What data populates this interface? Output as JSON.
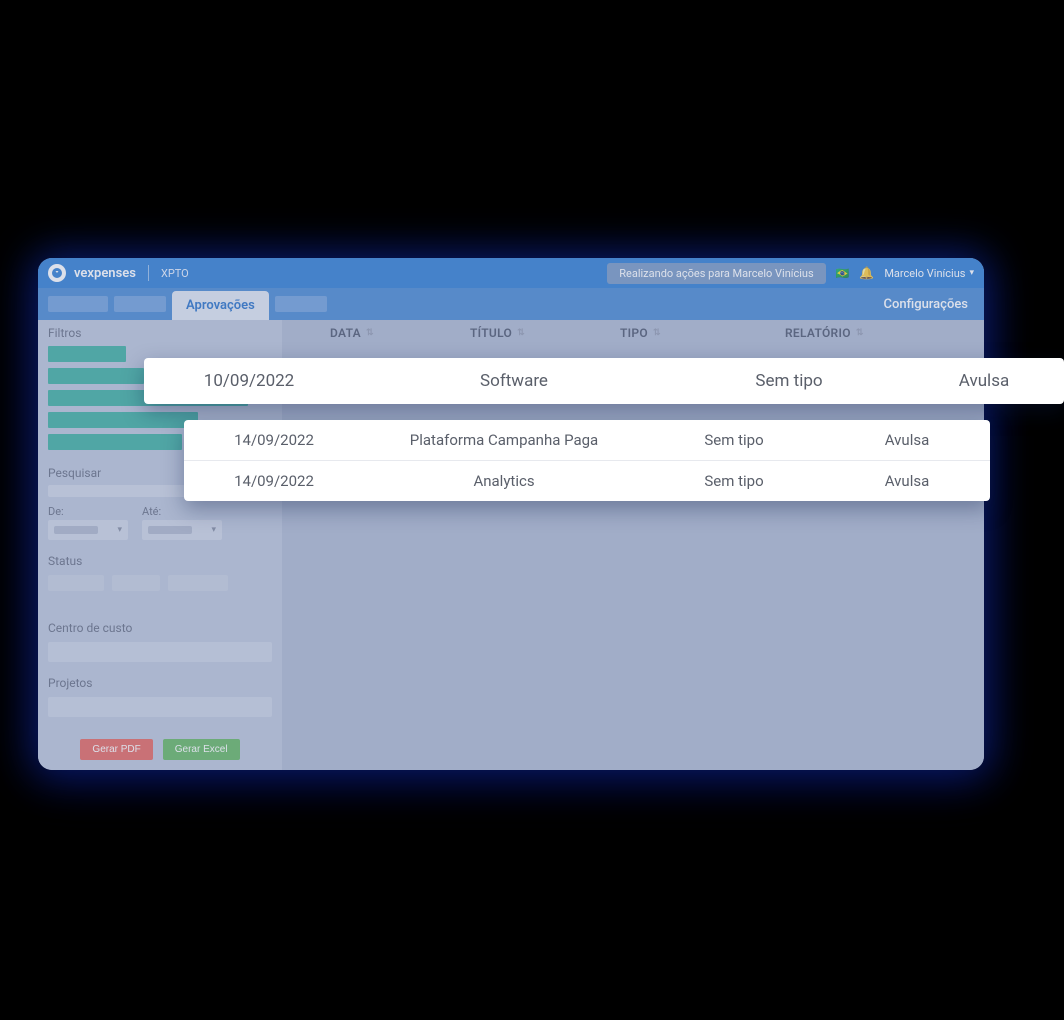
{
  "brand": "vexpenses",
  "company": "XPTO",
  "acting_as": "Realizando ações para Marcelo Vinícius",
  "user_name": "Marcelo Vinícius",
  "nav": {
    "active_tab": "Aprovações",
    "config": "Configurações"
  },
  "sidebar": {
    "filters_title": "Filtros",
    "search_label": "Pesquisar",
    "date_from_label": "De:",
    "date_to_label": "Até:",
    "status_label": "Status",
    "cost_center_label": "Centro de custo",
    "projects_label": "Projetos",
    "btn_pdf": "Gerar PDF",
    "btn_excel": "Gerar Excel"
  },
  "columns": {
    "data": "DATA",
    "titulo": "TÍTULO",
    "tipo": "TIPO",
    "relatorio": "RELATÓRIO"
  },
  "rows": [
    {
      "date": "10/09/2022",
      "title": "Software",
      "type": "Sem tipo",
      "report": "Avulsa"
    },
    {
      "date": "14/09/2022",
      "title": "Plataforma Campanha Paga",
      "type": "Sem tipo",
      "report": "Avulsa"
    },
    {
      "date": "14/09/2022",
      "title": "Analytics",
      "type": "Sem tipo",
      "report": "Avulsa"
    }
  ]
}
